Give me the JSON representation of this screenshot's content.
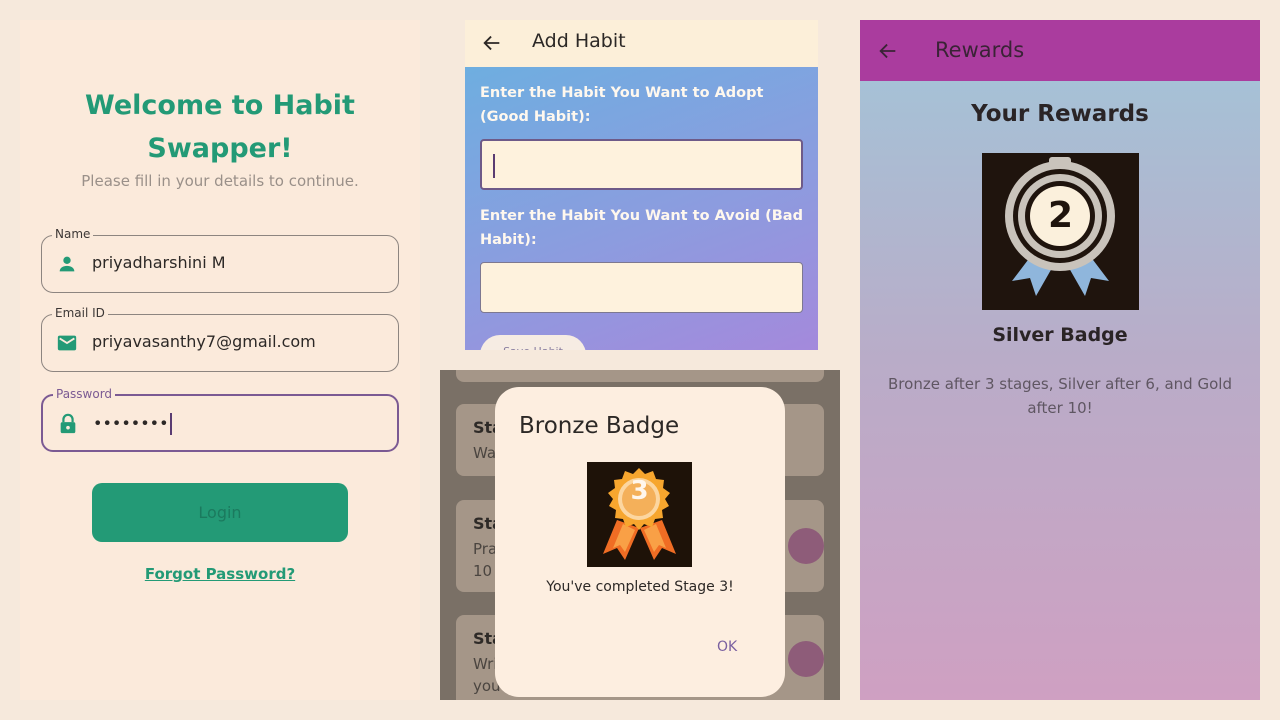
{
  "login": {
    "title": "Welcome to Habit Swapper!",
    "subtitle": "Please fill in your details to continue.",
    "name_label": "Name",
    "name_value": "priyadharshini M",
    "email_label": "Email ID",
    "email_value": "priyavasanthy7@gmail.com",
    "password_label": "Password",
    "password_value": "••••••••",
    "login_label": "Login",
    "forgot_label": "Forgot Password?",
    "accent_color": "#239a76",
    "icons": [
      "person-icon",
      "email-icon",
      "lock-icon"
    ]
  },
  "add_habit": {
    "title": "Add Habit",
    "good_label": "Enter the Habit You Want to Adopt (Good Habit):",
    "good_value": "",
    "bad_label": "Enter the Habit You Want to Avoid (Bad Habit):",
    "bad_value": "",
    "save_label": "Save Habit",
    "icons": [
      "back-arrow-icon"
    ]
  },
  "stages": {
    "cards": [
      {
        "title": "Sta",
        "desc": "Wa"
      },
      {
        "title": "Sta",
        "desc": "Pra 10"
      },
      {
        "title": "Sta",
        "desc": "Wri you"
      }
    ]
  },
  "dialog": {
    "title": "Bronze Badge",
    "badge_number": "3",
    "message": "You've completed Stage 3!",
    "ok_label": "OK"
  },
  "rewards": {
    "title": "Rewards",
    "heading": "Your Rewards",
    "badge_number": "2",
    "badge_name": "Silver Badge",
    "info": "Bronze after 3 stages, Silver after 6, and Gold after 10!",
    "appbar_color": "#aa3c9e",
    "icons": [
      "back-arrow-icon",
      "silver-medal-icon"
    ]
  }
}
